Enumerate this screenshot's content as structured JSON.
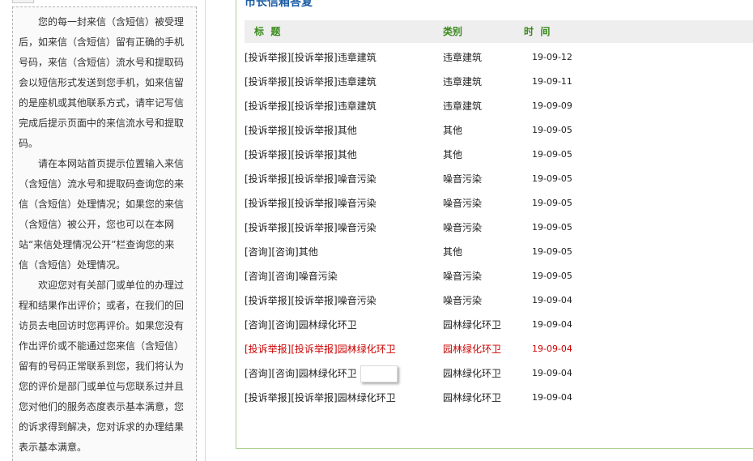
{
  "notice": {
    "paragraphs": [
      {
        "lines": [
          "您的每一封来信（含短信）被受理",
          "后，如来信（含短信）留有正确的手机",
          "号码，来信（含短信）流水号和提取码",
          "会以短信形式发送到您手机，如来信留",
          "的是座机或其他联系方式，请牢记写信",
          "完成后提示页面中的来信流水号和提取",
          "码。"
        ]
      },
      {
        "lines": [
          "请在本网站首页提示位置输入来信",
          "（含短信）流水号和提取码查询您的来",
          "信（含短信）处理情况；如果您的来信",
          "（含短信）被公开，您也可以在本网",
          "站“来信处理情况公开”栏查询您的来",
          "信（含短信）处理情况。"
        ]
      },
      {
        "lines": [
          "欢迎您对有关部门或单位的办理过",
          "程和结果作出评价；或者，在我们的回",
          "访员去电回访时您再评价。如果您没有",
          "作出评价或不能通过您来信（含短信）",
          "留有的号码正常联系到您，我们将认为",
          "您的评价是部门或单位与您联系过并且",
          "您对他们的服务态度表示基本满意，您",
          "的诉求得到解决，您对诉求的办理结果",
          "表示基本满意。"
        ]
      }
    ]
  },
  "mailbox": {
    "title": "市长信箱答复",
    "columns": {
      "title": "标  题",
      "category": "类别",
      "date": "时  间"
    },
    "rows": [
      {
        "title": "[投诉举报][投诉举报]违章建筑",
        "category": "违章建筑",
        "date": "19-09-12"
      },
      {
        "title": "[投诉举报][投诉举报]违章建筑",
        "category": "违章建筑",
        "date": "19-09-11"
      },
      {
        "title": "[投诉举报][投诉举报]违章建筑",
        "category": "违章建筑",
        "date": "19-09-09"
      },
      {
        "title": "[投诉举报][投诉举报]其他",
        "category": "其他",
        "date": "19-09-05"
      },
      {
        "title": "[投诉举报][投诉举报]其他",
        "category": "其他",
        "date": "19-09-05"
      },
      {
        "title": "[投诉举报][投诉举报]噪音污染",
        "category": "噪音污染",
        "date": "19-09-05"
      },
      {
        "title": "[投诉举报][投诉举报]噪音污染",
        "category": "噪音污染",
        "date": "19-09-05"
      },
      {
        "title": "[投诉举报][投诉举报]噪音污染",
        "category": "噪音污染",
        "date": "19-09-05"
      },
      {
        "title": "[咨询][咨询]其他",
        "category": "其他",
        "date": "19-09-05"
      },
      {
        "title": "[咨询][咨询]噪音污染",
        "category": "噪音污染",
        "date": "19-09-05"
      },
      {
        "title": "[投诉举报][投诉举报]噪音污染",
        "category": "噪音污染",
        "date": "19-09-04"
      },
      {
        "title": "[咨询][咨询]园林绿化环卫",
        "category": "园林绿化环卫",
        "date": "19-09-04"
      },
      {
        "title": "[投诉举报][投诉举报]园林绿化环卫",
        "category": "园林绿化环卫",
        "date": "19-09-04"
      },
      {
        "title": "[咨询][咨询]园林绿化环卫",
        "category": "园林绿化环卫",
        "date": "19-09-04"
      },
      {
        "title": "[投诉举报][投诉举报]园林绿化环卫",
        "category": "园林绿化环卫",
        "date": "19-09-04"
      }
    ]
  },
  "colors": {
    "panel_border": "#aed193",
    "title": "#1c5ea6",
    "header_text": "#3a8a1c",
    "header_bg": "#eeeeee",
    "hover_row": "#cc0000"
  }
}
